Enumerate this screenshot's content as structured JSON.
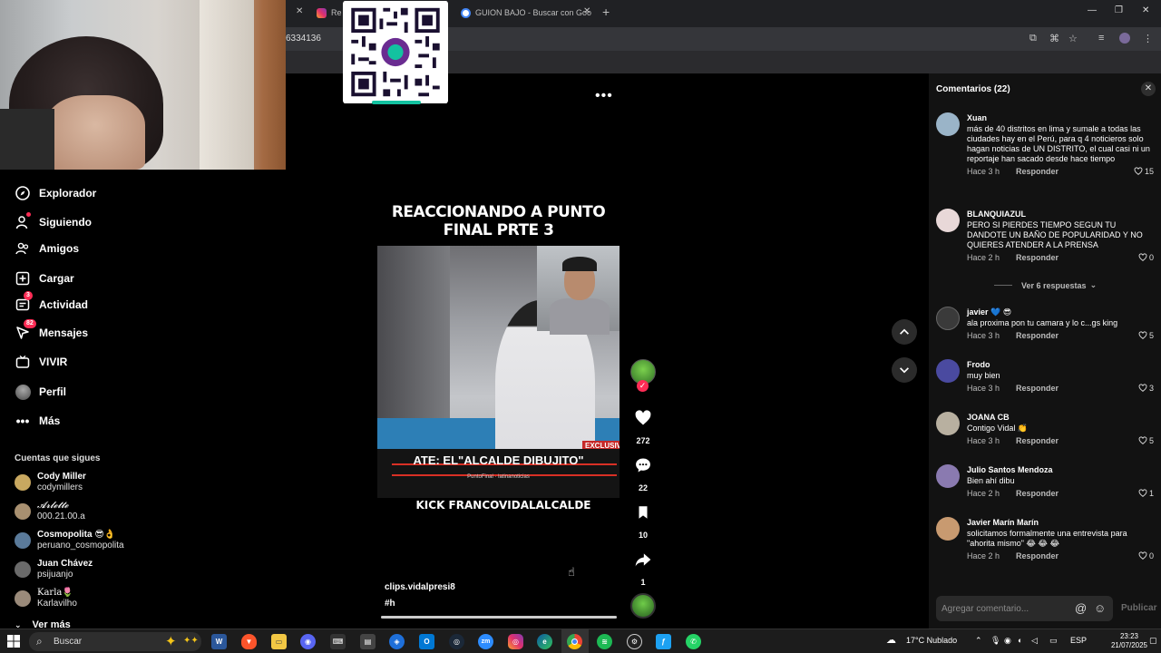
{
  "browser": {
    "tabs": [
      {
        "label": "Re",
        "icon": "instagram-icon"
      },
      {
        "label": "GUION BAJO - Buscar con Goo",
        "icon": "google-icon"
      }
    ],
    "address_fragment": "6334136"
  },
  "sidebar": {
    "nav": [
      {
        "label": "Explorador",
        "icon": "compass-icon"
      },
      {
        "label": "Siguiendo",
        "icon": "user-follow-icon"
      },
      {
        "label": "Amigos",
        "icon": "friends-icon"
      },
      {
        "label": "Cargar",
        "icon": "upload-icon"
      },
      {
        "label": "Actividad",
        "icon": "activity-icon",
        "badge": "3"
      },
      {
        "label": "Mensajes",
        "icon": "messages-icon",
        "badge": "82"
      },
      {
        "label": "VIVIR",
        "icon": "live-tv-icon"
      },
      {
        "label": "Perfil",
        "icon": "profile-avatar"
      },
      {
        "label": "Más",
        "icon": "more-dots-icon"
      }
    ],
    "following_header": "Cuentas que sigues",
    "following": [
      {
        "name": "Cody Miller",
        "handle": "codymillers"
      },
      {
        "name": "𝓐𝓻𝓵𝓮𝓽𝓽𝓮",
        "handle": "000.21.00.a"
      },
      {
        "name": "Cosmopolita 😎👌",
        "handle": "peruano_cosmopolita"
      },
      {
        "name": "Juan Chávez",
        "handle": "psijuanjo"
      },
      {
        "name": "Karla🌷",
        "handle": "Karlavilho"
      }
    ],
    "see_more": "Ver más"
  },
  "video": {
    "title": "REACCIONANDO A PUNTO FINAL PRTE 3",
    "caption": "ATE: EL\"ALCALDE DIBUJITO\"",
    "caption_sub": "PuntoFinal  ·  latinanoticias",
    "exclusive": "EXCLUSIV",
    "overlay_text": "KICK FRANCOVIDALALCALDE",
    "author": "clips.vidalpresi8",
    "hashtag": "#h",
    "progress": 0.999,
    "likes": "272",
    "comments": "22",
    "saves": "10",
    "shares": "1"
  },
  "comments_panel": {
    "title": "Comentarios (22)",
    "see_replies": "Ver 6 respuestas",
    "reply_label": "Responder",
    "items": [
      {
        "user": "Xuan",
        "text": "más de 40 distritos en lima y sumale a todas las ciudades hay en el Perú, para q 4 noticieros solo hagan noticias de UN DISTRITO, el cual casi ni un reportaje han sacado desde hace tiempo",
        "time": "Hace 3 h",
        "likes": "15",
        "color": "#9ab4c8"
      },
      {
        "user": "BLANQUIAZUL",
        "text": "PERO SI PIERDES TIEMPO SEGUN TU DANDOTE UN BAÑO DE POPULARIDAD Y NO QUIERES ATENDER A LA PRENSA",
        "time": "Hace 2 h",
        "likes": "0",
        "color": "#e8d8d8"
      },
      {
        "user": "javier 💙 😎",
        "text": "ala proxima pon tu camara y lo c...gs king",
        "time": "Hace 3 h",
        "likes": "5",
        "color": "#3a3a3a"
      },
      {
        "user": "Frodo",
        "text": "muy bien",
        "time": "Hace 3 h",
        "likes": "3",
        "color": "#4a4aa0"
      },
      {
        "user": "JOANA CB",
        "text": "Contigo Vidal 👏",
        "time": "Hace 3 h",
        "likes": "5",
        "color": "#b8b0a0"
      },
      {
        "user": "Julio Santos Mendoza",
        "text": "Bien ahí dibu",
        "time": "Hace 2 h",
        "likes": "1",
        "color": "#8a7ab0"
      },
      {
        "user": "Javier Marín Marín",
        "text": "solicitamos formalmente una entrevista para \"ahorita mismo\" 😂 😂 😂",
        "time": "Hace 2 h",
        "likes": "0",
        "color": "#c89a70"
      }
    ],
    "input_placeholder": "Agregar comentario...",
    "publish": "Publicar"
  },
  "taskbar": {
    "search": "Buscar",
    "weather": "17°C  Nublado",
    "lang": "ESP",
    "time": "23:23",
    "date": "21/07/2025"
  }
}
